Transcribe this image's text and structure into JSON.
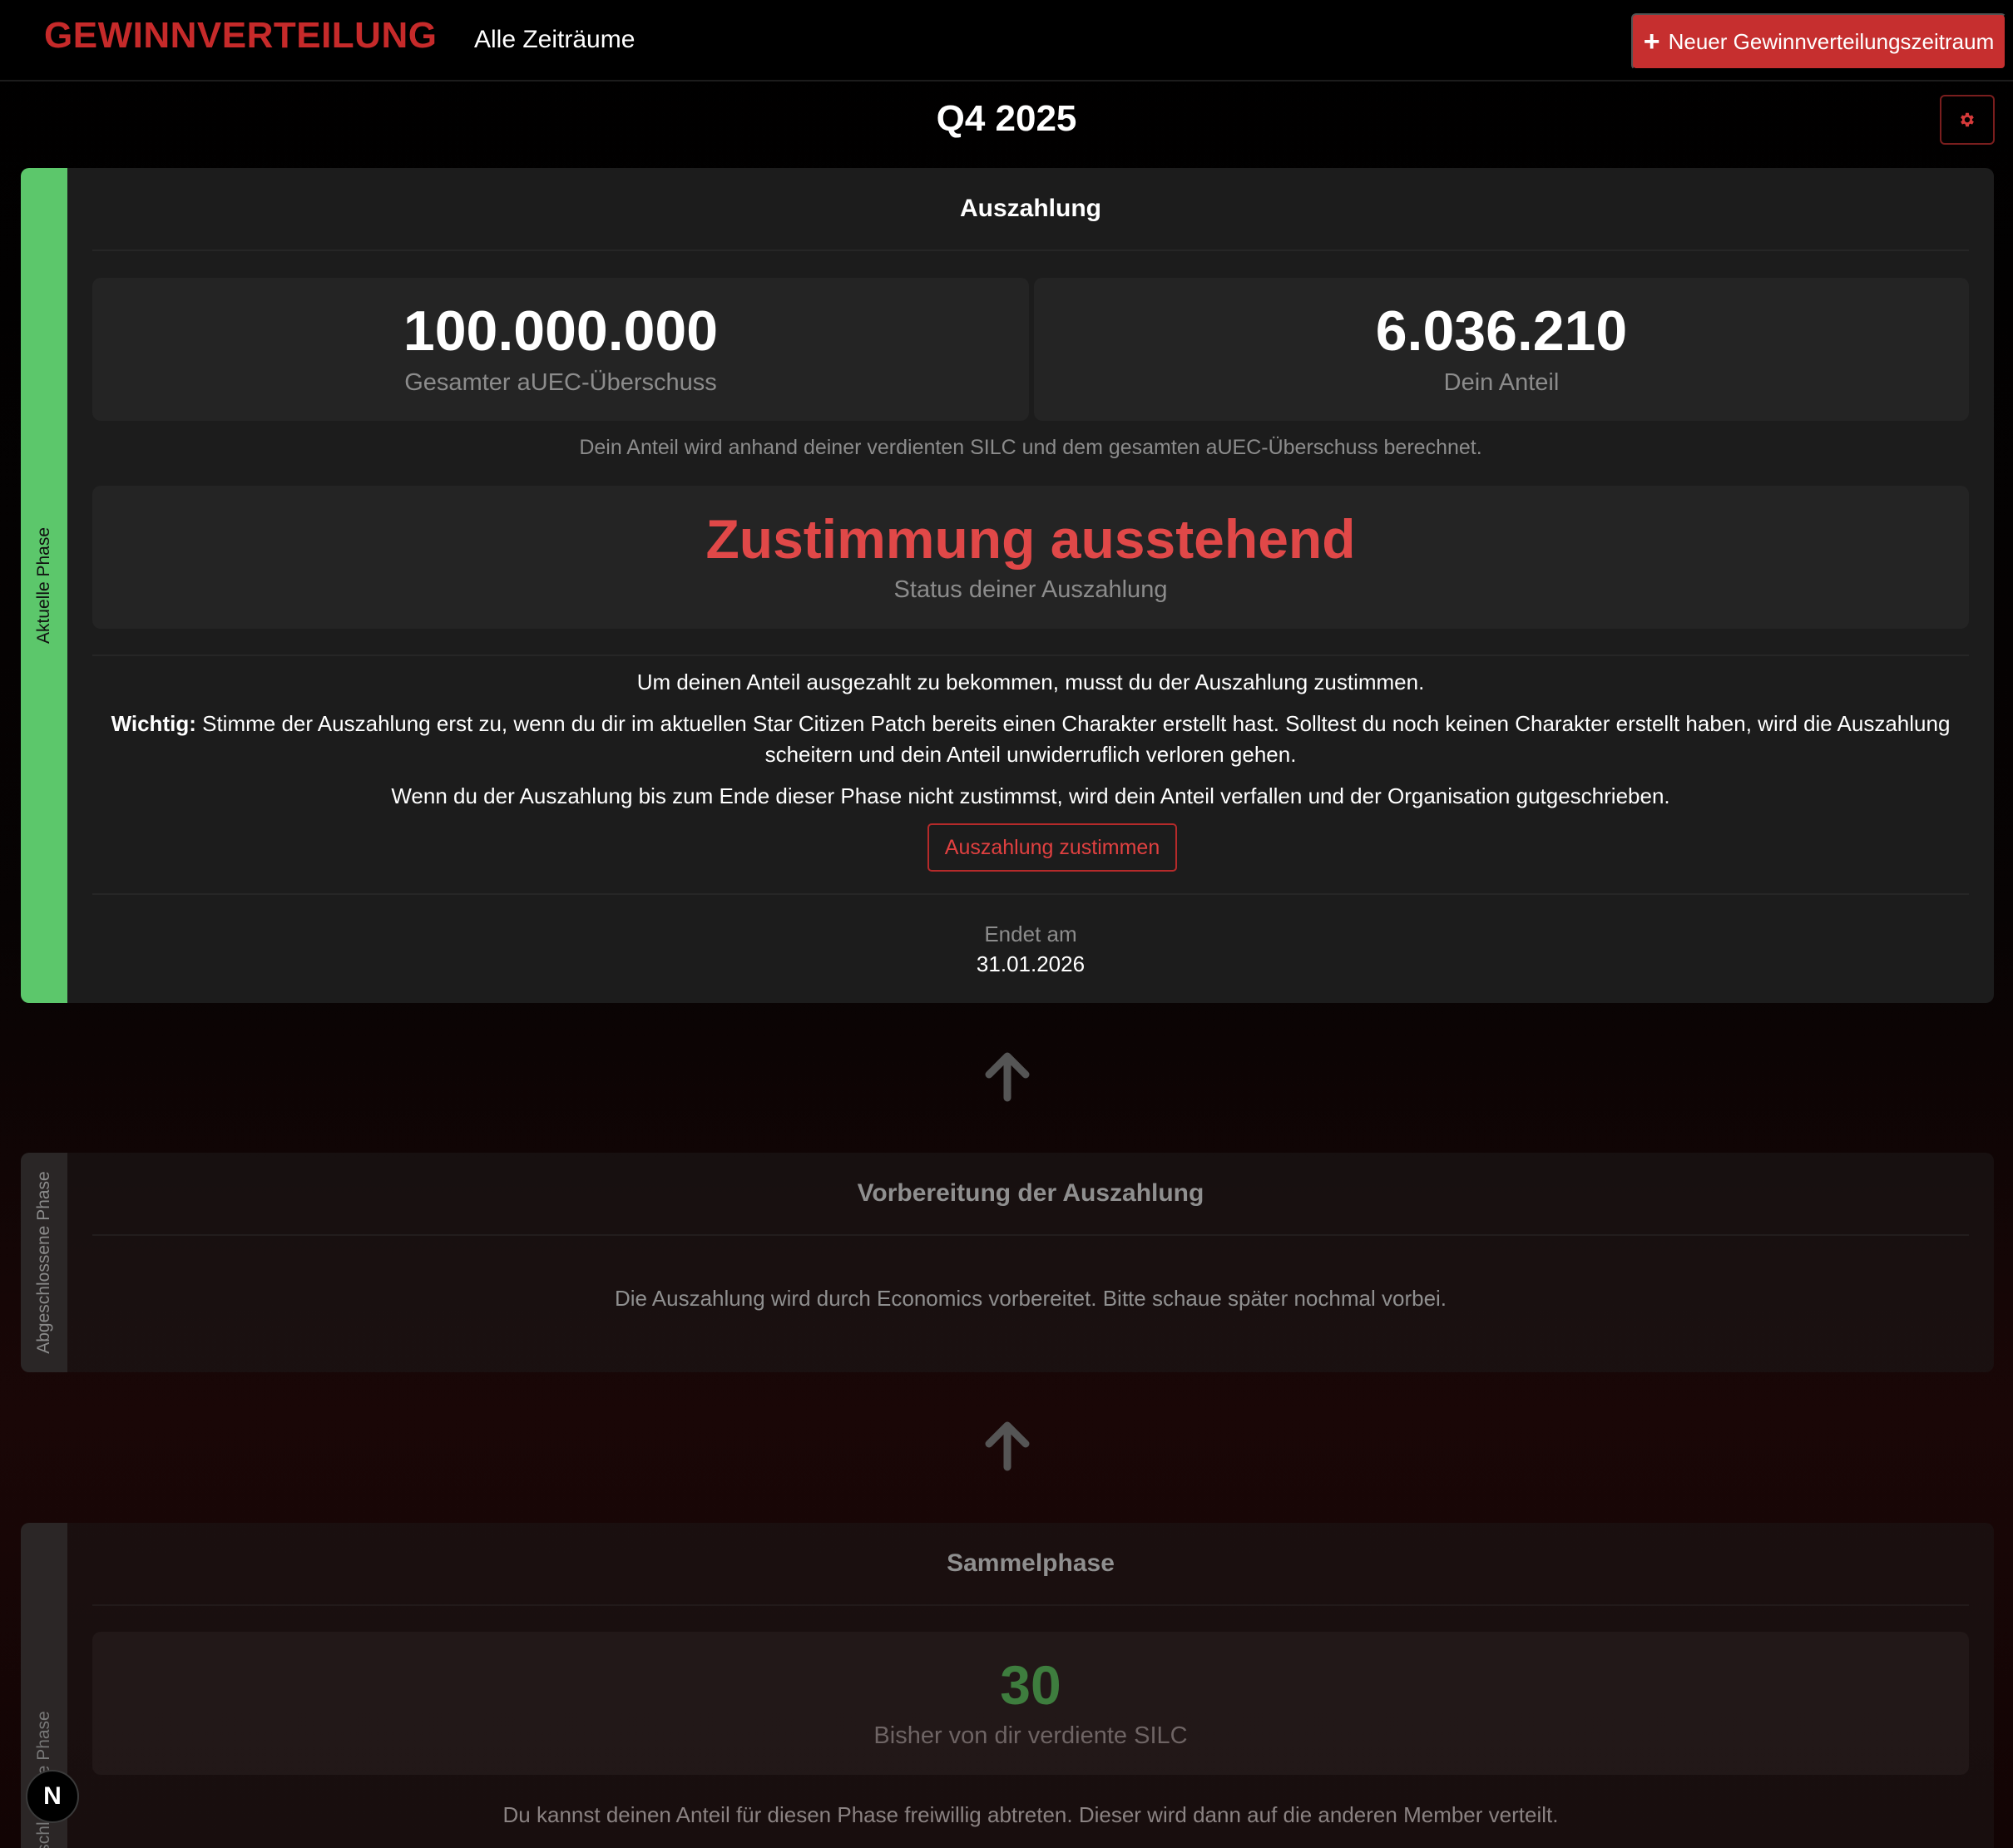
{
  "header": {
    "brand": "GEWINNVERTEILUNG",
    "nav_all_periods": "Alle Zeiträume",
    "new_period_button": "Neuer Gewinnverteilungszeitraum"
  },
  "period": {
    "title": "Q4 2025"
  },
  "current_phase": {
    "rail_label": "Aktuelle Phase",
    "heading": "Auszahlung",
    "total_surplus_value": "100.000.000",
    "total_surplus_label": "Gesamter aUEC-Überschuss",
    "your_share_value": "6.036.210",
    "your_share_label": "Dein Anteil",
    "share_hint": "Dein Anteil wird anhand deiner verdienten SILC und dem gesamten aUEC-Überschuss berechnet.",
    "status_value": "Zustimmung ausstehend",
    "status_label": "Status deiner Auszahlung",
    "info_line_1": "Um deinen Anteil ausgezahlt zu bekommen, musst du der Auszahlung zustimmen.",
    "important_label": "Wichtig:",
    "important_text": " Stimme der Auszahlung erst zu, wenn du dir im aktuellen Star Citizen Patch bereits einen Charakter erstellt hast. Solltest du noch keinen Charakter erstellt haben, wird die Auszahlung scheitern und dein Anteil unwiderruflich verloren gehen.",
    "info_line_3": "Wenn du der Auszahlung bis zum Ende dieser Phase nicht zustimmst, wird dein Anteil verfallen und der Organisation gutgeschrieben.",
    "consent_button": "Auszahlung zustimmen",
    "ends_label": "Endet am",
    "ends_date": "31.01.2026"
  },
  "prep_phase": {
    "rail_label": "Abgeschlossene Phase",
    "heading": "Vorbereitung der Auszahlung",
    "message": "Die Auszahlung wird durch Economics vorbereitet. Bitte schaue später nochmal vorbei."
  },
  "collect_phase": {
    "rail_label": "Abgeschlossene Phase",
    "heading": "Sammelphase",
    "silc_value": "30",
    "silc_label": "Bisher von dir verdiente SILC",
    "waive_hint": "Du kannst deinen Anteil für diesen Phase freiwillig abtreten. Dieser wird dann auf die anderen Member verteilt."
  },
  "badge": {
    "letter": "N"
  },
  "colors": {
    "accent_red": "#c62f2f",
    "status_red": "#e04848",
    "current_phase_green": "#5cc76b",
    "silc_green": "#3e7d3e"
  },
  "icons": [
    "plus-icon",
    "gear-icon",
    "arrow-up-icon"
  ]
}
